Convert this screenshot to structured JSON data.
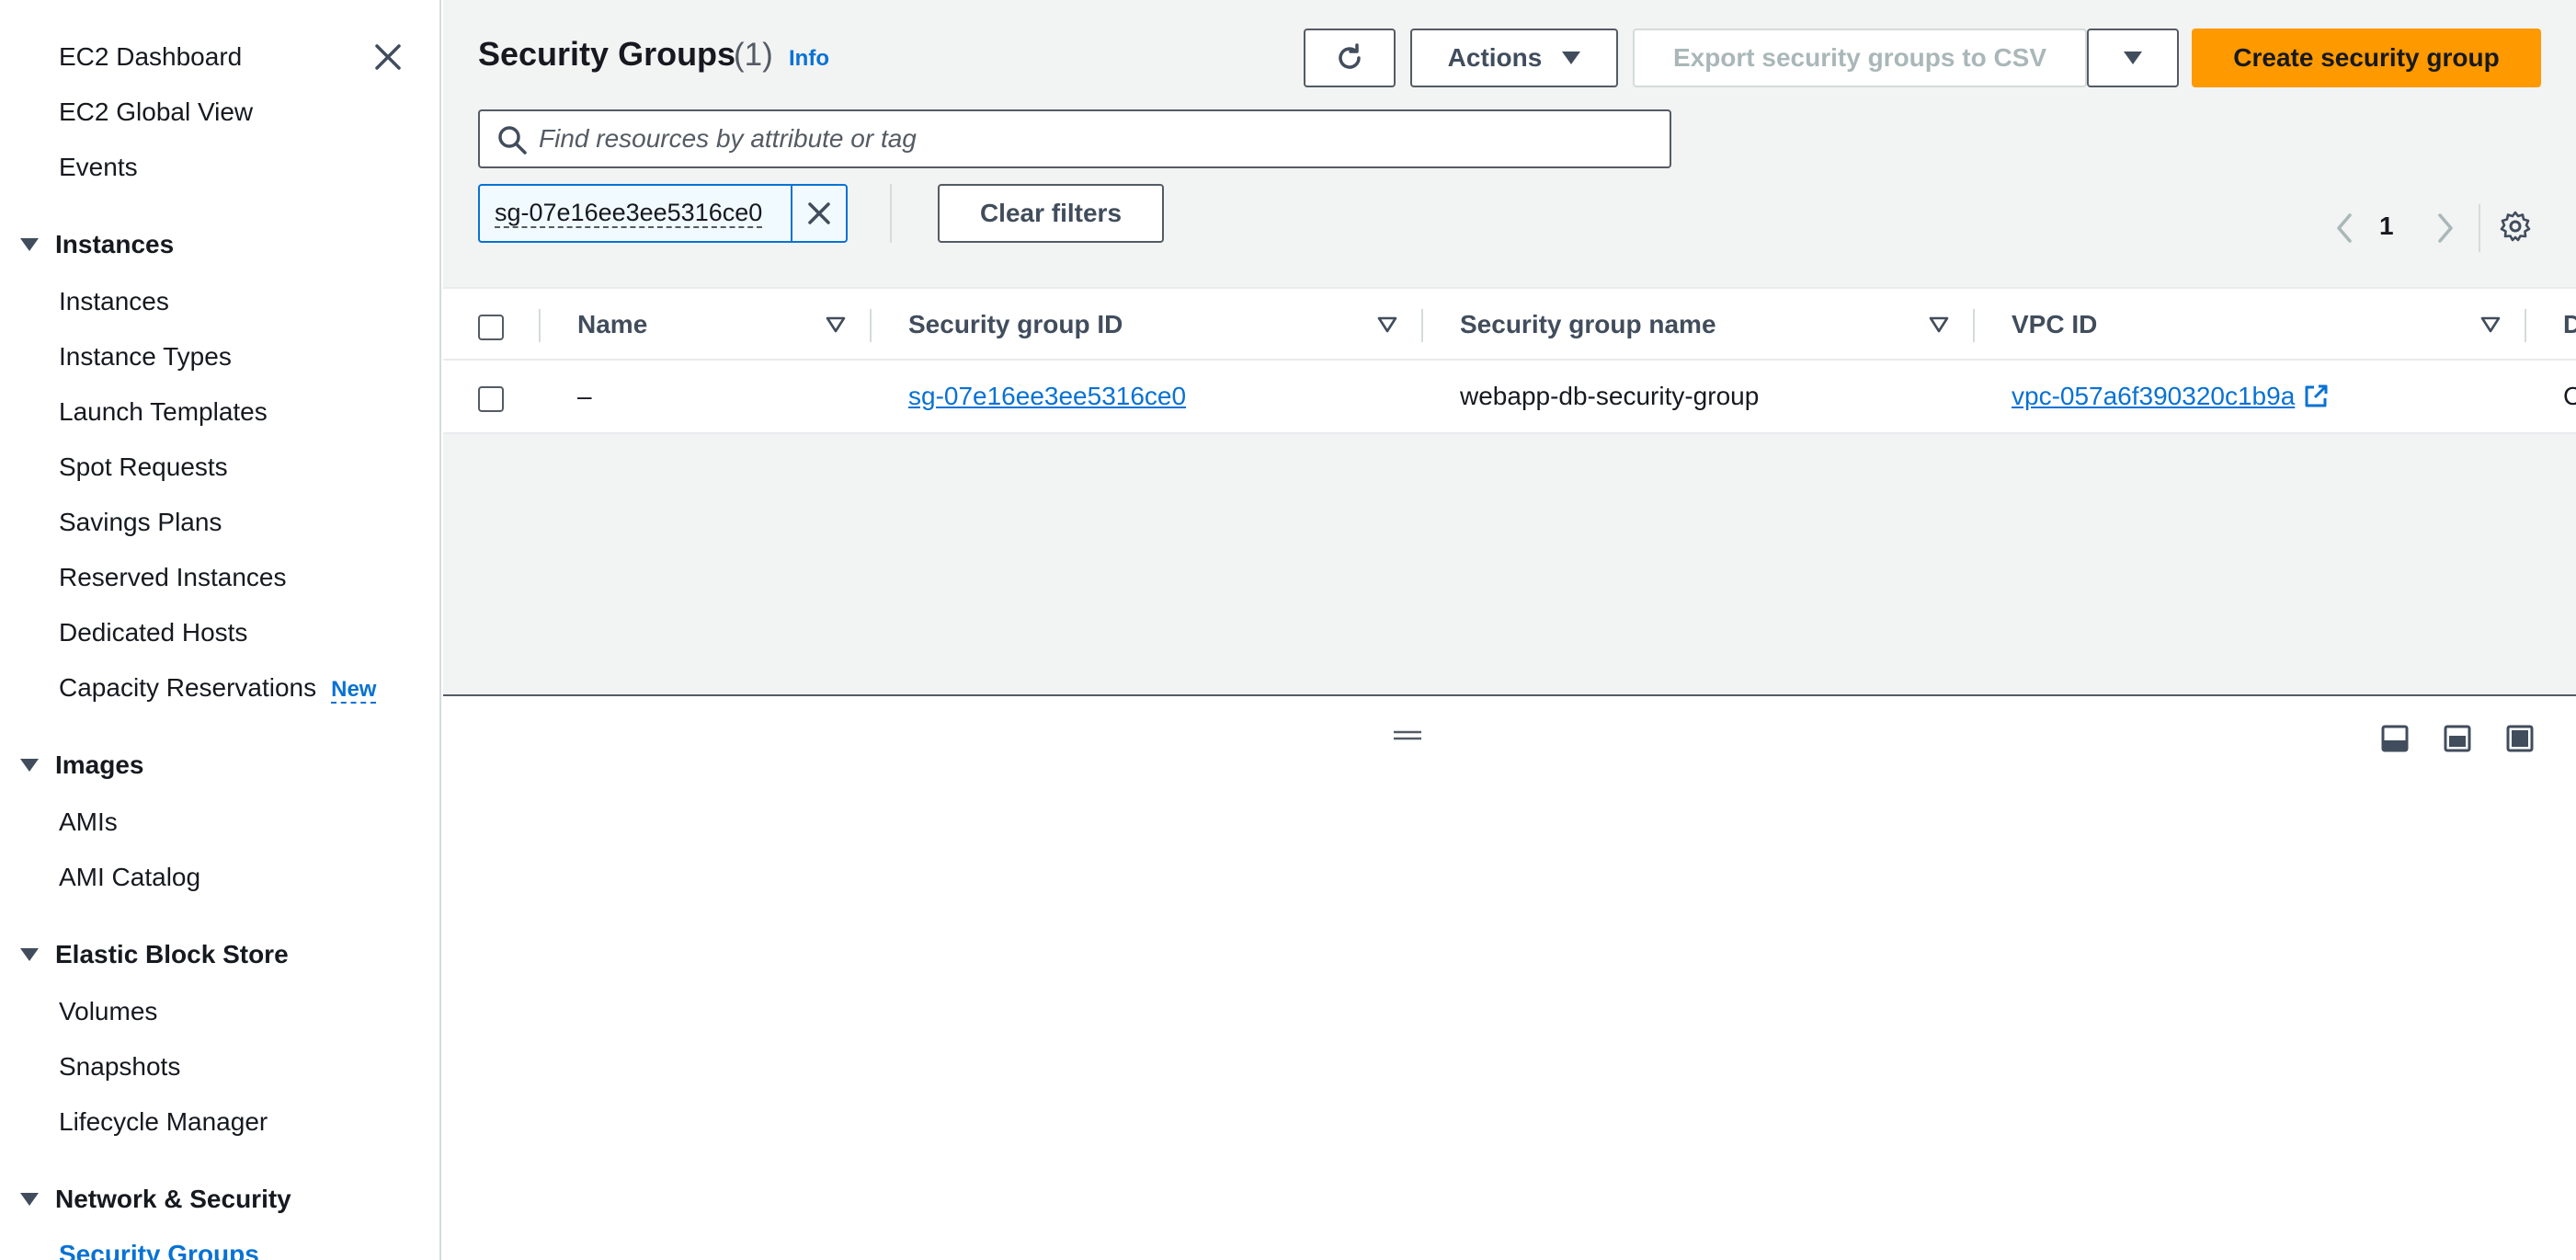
{
  "sidebar": {
    "items_top": [
      "EC2 Dashboard",
      "EC2 Global View",
      "Events"
    ],
    "sections": [
      {
        "title": "Instances",
        "items": [
          "Instances",
          "Instance Types",
          "Launch Templates",
          "Spot Requests",
          "Savings Plans",
          "Reserved Instances",
          "Dedicated Hosts",
          "Capacity Reservations"
        ],
        "badge": "New"
      },
      {
        "title": "Images",
        "items": [
          "AMIs",
          "AMI Catalog"
        ]
      },
      {
        "title": "Elastic Block Store",
        "items": [
          "Volumes",
          "Snapshots",
          "Lifecycle Manager"
        ]
      },
      {
        "title": "Network & Security",
        "items": [
          "Security Groups"
        ]
      }
    ]
  },
  "header": {
    "title": "Security Groups",
    "count": "(1)",
    "info": "Info",
    "actions_label": "Actions",
    "export_label": "Export security groups to CSV",
    "create_label": "Create security group"
  },
  "search": {
    "placeholder": "Find resources by attribute or tag",
    "value": ""
  },
  "filter": {
    "token": "sg-07e16ee3ee5316ce0",
    "clear_label": "Clear filters"
  },
  "pagination": {
    "current_page": "1"
  },
  "table": {
    "columns": [
      "Name",
      "Security group ID",
      "Security group name",
      "VPC ID",
      "D"
    ],
    "rows": [
      {
        "name": "–",
        "sg_id": "sg-07e16ee3ee5316ce0",
        "sg_name": "webapp-db-security-group",
        "vpc_id": "vpc-057a6f390320c1b9a",
        "desc": "C"
      }
    ]
  },
  "colors": {
    "accent": "#0972d3",
    "primary_button": "#ff9900",
    "panel_bg": "#f2f3f3"
  }
}
